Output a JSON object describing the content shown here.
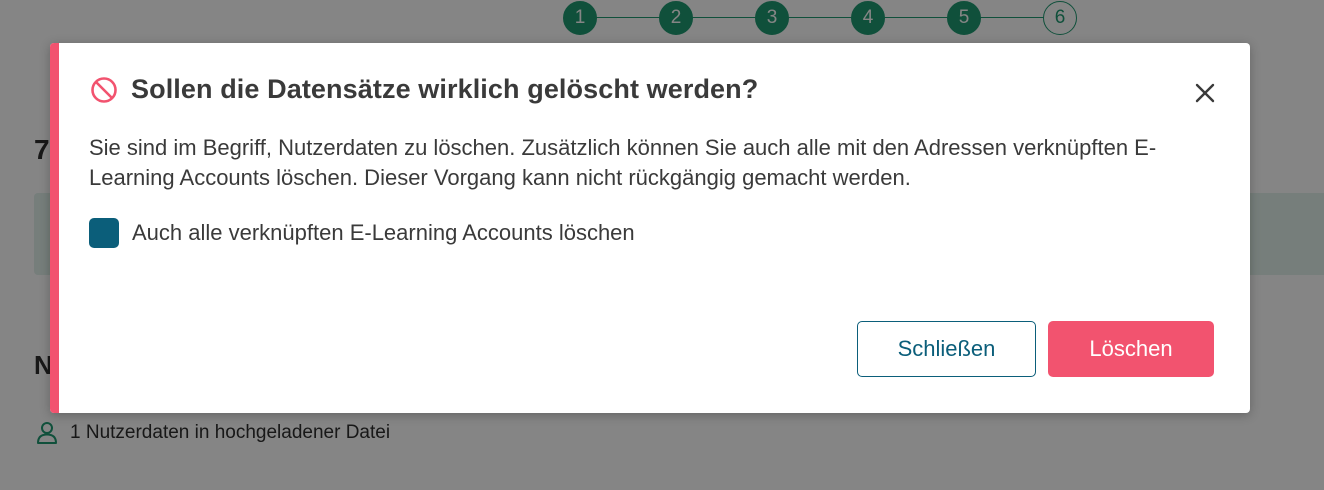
{
  "stepper": {
    "steps": [
      "1",
      "2",
      "3",
      "4",
      "5",
      "6"
    ],
    "completed_color": "#1f9a72"
  },
  "background": {
    "heading_a": "7",
    "heading_b": "N",
    "count_text": "1 Nutzerdaten in hochgeladener Datei",
    "count_icon": "user-icon"
  },
  "dialog": {
    "accent_color": "#f2536f",
    "title_icon": "prohibited-icon",
    "title": "Sollen die Datensätze wirklich gelöscht werden?",
    "close_icon": "close-icon",
    "body": "Sie sind im Begriff, Nutzerdaten zu löschen. Zusätzlich können Sie auch alle mit den Adressen verknüpften E-Learning Accounts löschen. Dieser Vorgang kann nicht rückgängig gemacht werden.",
    "checkbox": {
      "label": "Auch alle verknüpften E-Learning Accounts löschen",
      "checked": false
    },
    "buttons": {
      "close_label": "Schließen",
      "delete_label": "Löschen"
    }
  },
  "colors": {
    "primary": "#0b5e7a",
    "danger": "#f2536f",
    "success": "#1f9a72"
  }
}
